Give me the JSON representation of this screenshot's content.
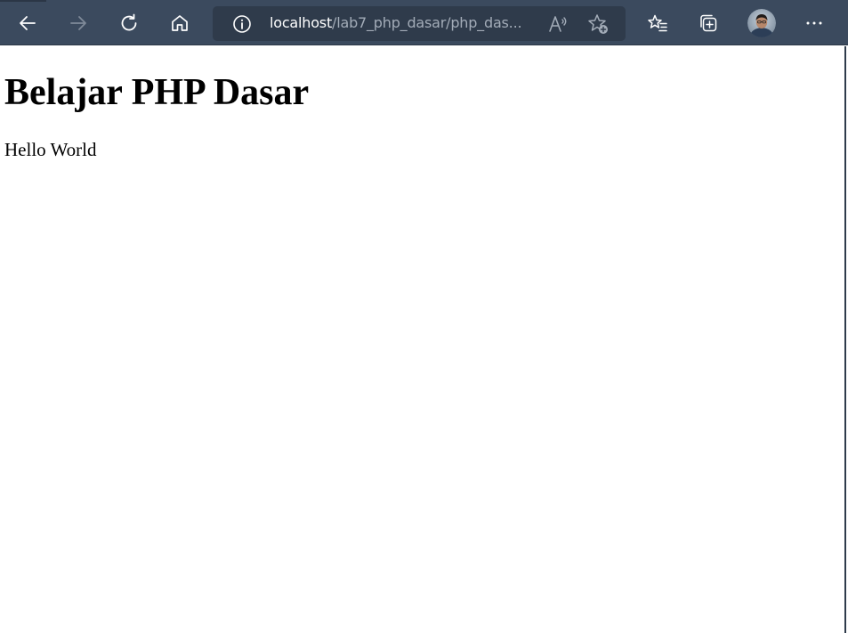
{
  "browser": {
    "toolbar_color": "#3b4a5e",
    "address_bar": {
      "url_host": "localhost",
      "url_path": "/lab7_php_dasar/php_das..."
    },
    "buttons": {
      "back_icon": "arrow-left-icon",
      "forward_icon": "arrow-right-icon",
      "forward_enabled": false,
      "refresh_icon": "refresh-icon",
      "home_icon": "home-icon",
      "site_info_icon": "info-icon",
      "read_aloud_icon": "read-aloud-icon",
      "add_favorite_icon": "star-add-icon",
      "favorites_icon": "favorites-icon",
      "collections_icon": "collections-icon",
      "profile_icon": "avatar",
      "more_icon": "ellipsis-icon"
    }
  },
  "page": {
    "heading": "Belajar PHP Dasar",
    "paragraph": "Hello World"
  }
}
